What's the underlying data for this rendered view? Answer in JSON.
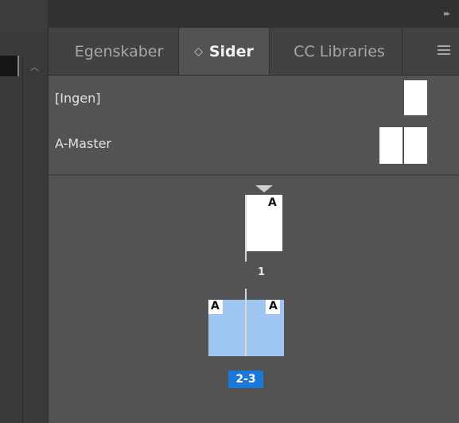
{
  "panel": {
    "tabs": [
      {
        "label": "Egenskaber"
      },
      {
        "label": "Sider",
        "icon": "sort-arrows-icon",
        "active": true
      },
      {
        "label": "CC Libraries"
      }
    ],
    "tab_icon_glyph": "◇",
    "collapse_glyph": "▸▸"
  },
  "masters": [
    {
      "label": "[Ingen]",
      "thumbnail": "single-page"
    },
    {
      "label": "A-Master",
      "thumbnail": "spread"
    }
  ],
  "pages": [
    {
      "master_letter": "A",
      "number": "1",
      "selected": false
    },
    {
      "master_letters": [
        "A",
        "A"
      ],
      "number": "2-3",
      "selected": true
    }
  ],
  "colors": {
    "panel_bg": "#535353",
    "selection": "#1c78d6",
    "selected_spread": "#9ec6f0"
  }
}
